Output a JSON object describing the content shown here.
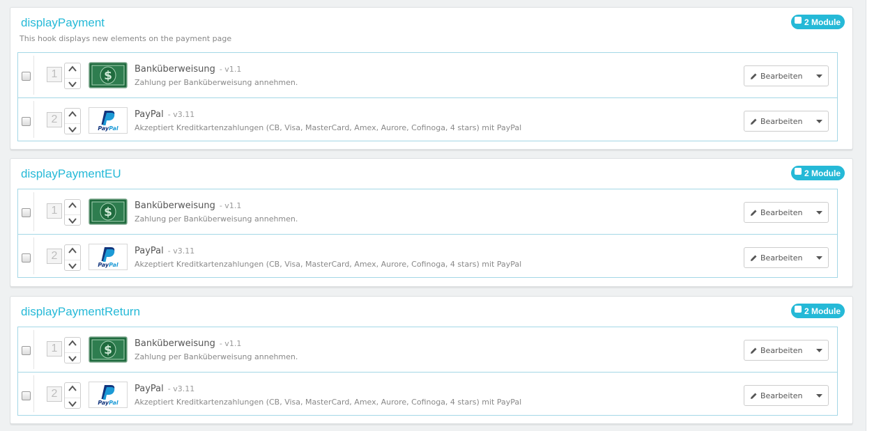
{
  "hooks": [
    {
      "name": "displayPayment",
      "description": "This hook displays new elements on the payment page",
      "module_count": "2 Module",
      "modules": [
        {
          "position": "1",
          "name": "Banküberweisung",
          "version": "- v1.1",
          "description": "Zahlung per Banküberweisung annehmen.",
          "icon": "bankwire-cash-icon",
          "edit_label": "Bearbeiten"
        },
        {
          "position": "2",
          "name": "PayPal",
          "version": "- v3.11",
          "description": "Akzeptiert Kreditkartenzahlungen (CB, Visa, MasterCard, Amex, Aurore, Cofinoga, 4 stars) mit PayPal",
          "icon": "paypal-logo-icon",
          "edit_label": "Bearbeiten"
        }
      ]
    },
    {
      "name": "displayPaymentEU",
      "description": "",
      "module_count": "2 Module",
      "modules": [
        {
          "position": "1",
          "name": "Banküberweisung",
          "version": "- v1.1",
          "description": "Zahlung per Banküberweisung annehmen.",
          "icon": "bankwire-cash-icon",
          "edit_label": "Bearbeiten"
        },
        {
          "position": "2",
          "name": "PayPal",
          "version": "- v3.11",
          "description": "Akzeptiert Kreditkartenzahlungen (CB, Visa, MasterCard, Amex, Aurore, Cofinoga, 4 stars) mit PayPal",
          "icon": "paypal-logo-icon",
          "edit_label": "Bearbeiten"
        }
      ]
    },
    {
      "name": "displayPaymentReturn",
      "description": "",
      "module_count": "2 Module",
      "modules": [
        {
          "position": "1",
          "name": "Banküberweisung",
          "version": "- v1.1",
          "description": "Zahlung per Banküberweisung annehmen.",
          "icon": "bankwire-cash-icon",
          "edit_label": "Bearbeiten"
        },
        {
          "position": "2",
          "name": "PayPal",
          "version": "- v3.11",
          "description": "Akzeptiert Kreditkartenzahlungen (CB, Visa, MasterCard, Amex, Aurore, Cofinoga, 4 stars) mit PayPal",
          "icon": "paypal-logo-icon",
          "edit_label": "Bearbeiten"
        }
      ]
    }
  ],
  "colors": {
    "accent": "#25b9d7",
    "list_border": "#a3d7e6",
    "cash_green": "#2e7d4f"
  }
}
